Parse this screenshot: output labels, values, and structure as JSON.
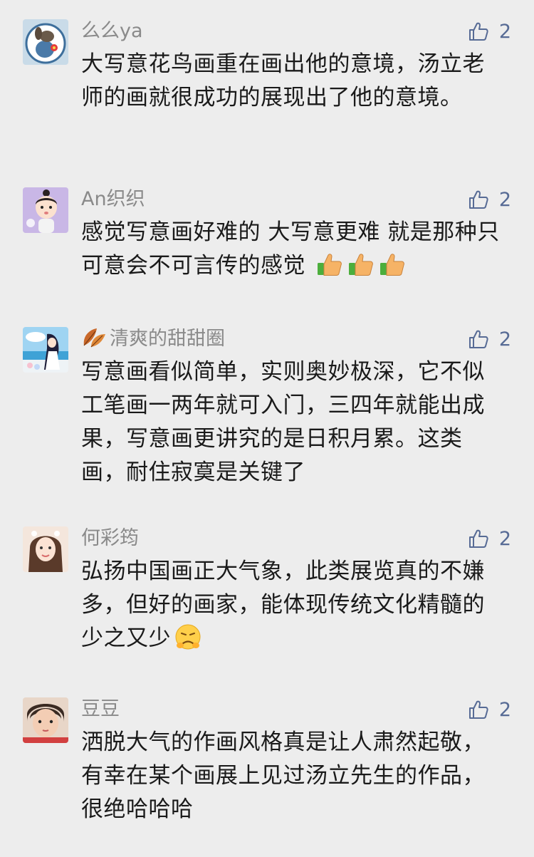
{
  "comments": [
    {
      "nickname": "么么ya",
      "likes": "2",
      "content": "大写意花鸟画重在画出他的意境，汤立老师的画就很成功的展现出了他的意境。",
      "avatar_icon": "cartoon-dog-avatar"
    },
    {
      "nickname": "An织织",
      "likes": "2",
      "content": "感觉写意画好难的 大写意更难 就是那种只可意会不可言传的感觉",
      "emojis": [
        "thumbs-up-emoji",
        "thumbs-up-emoji",
        "thumbs-up-emoji"
      ],
      "avatar_icon": "baby-girl-avatar"
    },
    {
      "nickname": "清爽的甜甜圈",
      "nickname_icon": "autumn-leaves-icon",
      "likes": "2",
      "content": "写意画看似简单，实则奥妙极深，它不似工笔画一两年就可入门，三四年就能出成果，写意画更讲究的是日积月累。这类画，耐住寂寞是关键了",
      "avatar_icon": "anime-girl-beach-avatar"
    },
    {
      "nickname": "何彩筠",
      "likes": "2",
      "content": "弘扬中国画正大气象，此类展览真的不嫌多，但好的画家，能体现传统文化精髓的少之又少",
      "emojis": [
        "sad-face-emoji"
      ],
      "avatar_icon": "woman-portrait-avatar"
    },
    {
      "nickname": "豆豆",
      "likes": "2",
      "content": "洒脱大气的作画风格真是让人肃然起敬，有幸在某个画展上见过汤立先生的作品，很绝哈哈哈",
      "avatar_icon": "child-portrait-avatar"
    }
  ],
  "colors": {
    "background": "#ededed",
    "nickname": "#8a8a8a",
    "like_accent": "#576b95",
    "text": "#1a1a1a"
  }
}
